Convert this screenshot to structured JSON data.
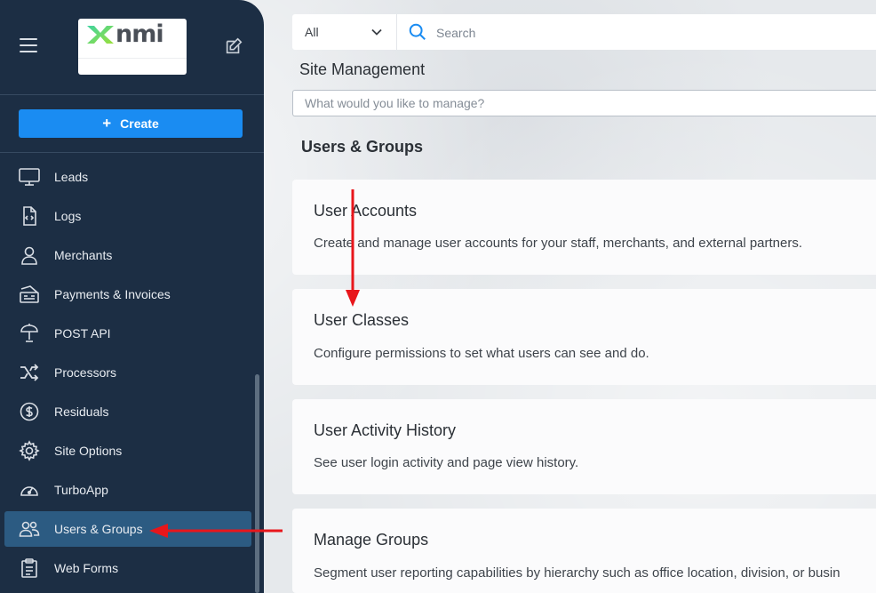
{
  "app": {
    "logo_text": "nmi",
    "accent_color": "#1a8cf2",
    "sidebar_color": "#1c2e44",
    "active_color": "#2c5b82"
  },
  "sidebar": {
    "create_label": "Create",
    "items": [
      {
        "label": "Leads",
        "icon": "monitor-icon"
      },
      {
        "label": "Logs",
        "icon": "code-file-icon"
      },
      {
        "label": "Merchants",
        "icon": "person-icon"
      },
      {
        "label": "Payments & Invoices",
        "icon": "invoice-icon"
      },
      {
        "label": "POST API",
        "icon": "satellite-icon"
      },
      {
        "label": "Processors",
        "icon": "shuffle-icon"
      },
      {
        "label": "Residuals",
        "icon": "dollar-circle-icon"
      },
      {
        "label": "Site Options",
        "icon": "gear-icon"
      },
      {
        "label": "TurboApp",
        "icon": "speedometer-icon"
      },
      {
        "label": "Users & Groups",
        "icon": "users-icon",
        "active": true
      },
      {
        "label": "Web Forms",
        "icon": "clipboard-icon"
      }
    ]
  },
  "search": {
    "scope_value": "All",
    "placeholder": "Search"
  },
  "main": {
    "page_title": "Site Management",
    "filter_placeholder": "What would you like to manage?",
    "section_title": "Users & Groups",
    "cards": [
      {
        "title": "User Accounts",
        "description": "Create and manage user accounts for your staff, merchants, and external partners."
      },
      {
        "title": "User Classes",
        "description": "Configure permissions to set what users can see and do."
      },
      {
        "title": "User Activity History",
        "description": "See user login activity and page view history."
      },
      {
        "title": "Manage Groups",
        "description": "Segment user reporting capabilities by hierarchy such as office location, division, or busin"
      }
    ]
  },
  "annotations": {
    "arrow_color": "#e8161b"
  }
}
